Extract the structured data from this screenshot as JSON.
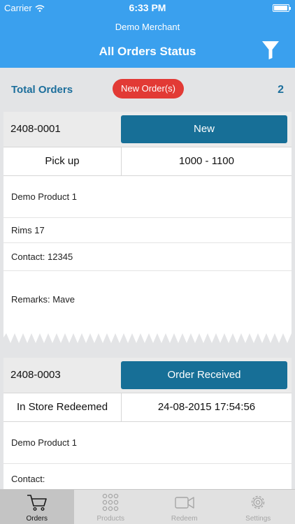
{
  "status_bar": {
    "carrier": "Carrier",
    "time": "6:33 PM"
  },
  "header": {
    "merchant": "Demo Merchant",
    "title": "All Orders Status"
  },
  "summary": {
    "total_label": "Total Orders",
    "new_badge": "New Order(s)",
    "count": "2"
  },
  "orders": [
    {
      "id": "2408-0001",
      "status": "New",
      "type": "Pick up",
      "time": "1000 - 1100",
      "product": "Demo Product 1",
      "option": "Rims 17",
      "contact": "Contact: 12345",
      "remarks": "Remarks: Mave"
    },
    {
      "id": "2408-0003",
      "status": "Order Received",
      "type": "In Store Redeemed",
      "time": "24-08-2015 17:54:56",
      "product": "Demo Product 1",
      "contact": "Contact:"
    }
  ],
  "tabs": [
    {
      "label": "Orders",
      "icon": "cart-icon",
      "active": true
    },
    {
      "label": "Products",
      "icon": "grid-icon",
      "active": false
    },
    {
      "label": "Redeem",
      "icon": "video-camera-icon",
      "active": false
    },
    {
      "label": "Settings",
      "icon": "gear-icon",
      "active": false
    }
  ],
  "colors": {
    "header": "#3aa0ee",
    "accent": "#1d6f9c",
    "status_button": "#176f97",
    "badge": "#e23a35"
  }
}
